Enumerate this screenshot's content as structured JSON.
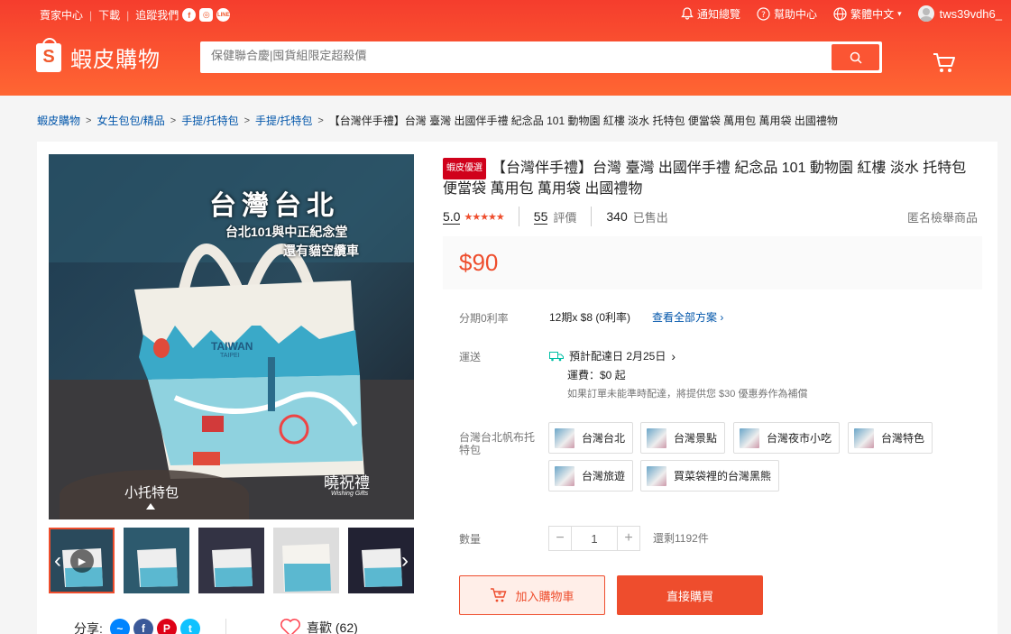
{
  "topbar": {
    "seller_center": "賣家中心",
    "download": "下載",
    "follow": "追蹤我們",
    "notifications": "通知總覽",
    "help": "幫助中心",
    "language": "繁體中文",
    "username": "tws39vdh6_"
  },
  "header": {
    "brand": "蝦皮購物",
    "search_placeholder": "保健聯合慶|囤貨組限定超殺價"
  },
  "breadcrumb": [
    "蝦皮購物",
    "女生包包/精品",
    "手提/托特包",
    "手提/托特包",
    "【台灣伴手禮】台灣 臺灣 出國伴手禮 紀念品 101 動物園 紅樓 淡水 托特包 便當袋 萬用包 萬用袋 出國禮物"
  ],
  "product": {
    "badge": "蝦皮優選",
    "title": "【台灣伴手禮】台灣 臺灣 出國伴手禮 紀念品 101 動物園 紅樓 淡水 托特包 便當袋 萬用包 萬用袋 出國禮物",
    "rating": "5.0",
    "reviews_count": "55",
    "reviews_label": "評價",
    "sold_count": "340",
    "sold_label": "已售出",
    "report": "匿名檢舉商品",
    "price": "$90",
    "image_caption": "小托特包",
    "image_text": {
      "title": "台灣台北",
      "line1": "台北101與中正紀念堂",
      "line2": "還有貓空纜車",
      "bag_text1": "TAIWAN",
      "bag_text2": "TAIPEI",
      "brand": "曉祝禮",
      "brand_sub": "Wishing Gifts"
    }
  },
  "installment": {
    "label": "分期0利率",
    "value": "12期x $8 (0利率)",
    "link": "查看全部方案"
  },
  "shipping": {
    "label": "運送",
    "eta": "預計配達日 2月25日",
    "fee": "運費：$0 起",
    "note": "如果訂單未能準時配達，將提供您 $30 優惠券作為補償"
  },
  "variations": {
    "label": "台灣台北帆布托特包",
    "options": [
      "台灣台北",
      "台灣景點",
      "台灣夜市小吃",
      "台灣特色",
      "台灣旅遊",
      "買菜袋裡的台灣黑熊"
    ]
  },
  "quantity": {
    "label": "數量",
    "value": "1",
    "stock": "還剩1192件"
  },
  "actions": {
    "add_to_cart": "加入購物車",
    "buy_now": "直接購買"
  },
  "social": {
    "share": "分享:",
    "like": "喜歡 (62)"
  }
}
